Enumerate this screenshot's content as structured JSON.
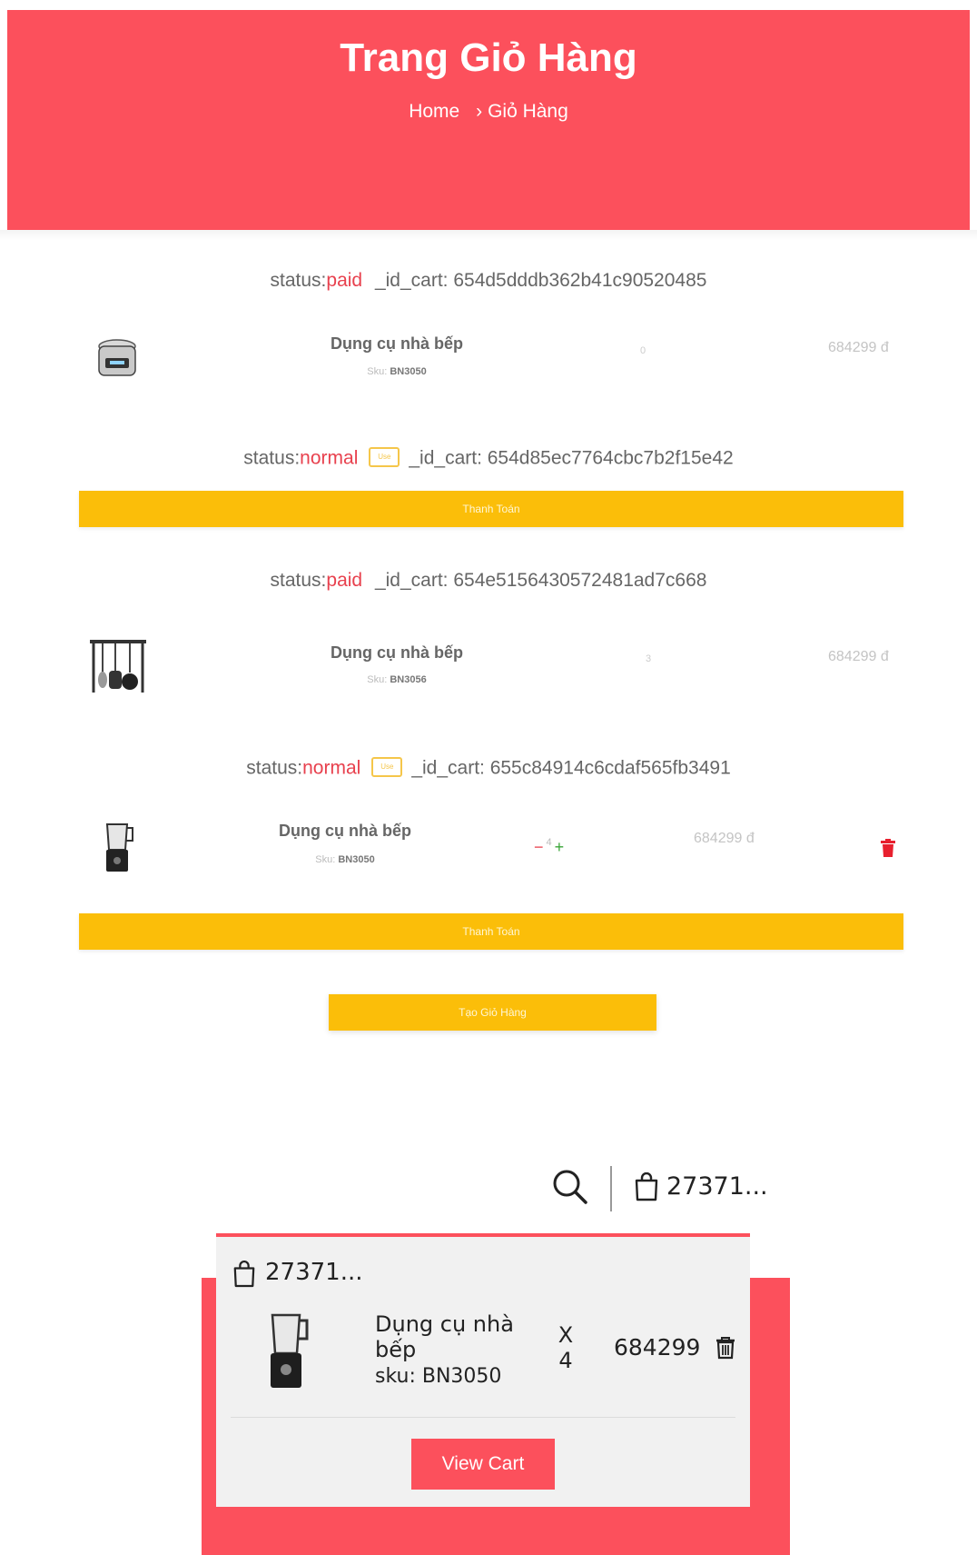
{
  "page": {
    "title": "Trang Giỏ Hàng",
    "breadcrumb": {
      "home": "Home",
      "separator": "›",
      "current": "Giỏ Hàng"
    }
  },
  "colors": {
    "accent": "#fc505c",
    "button": "#fbbe09",
    "status": "#e8414e",
    "plus": "#39a537"
  },
  "carts": [
    {
      "status_prefix": "status:",
      "status": "paid",
      "id_text": "_id_cart: 654d5dddb362b41c90520485",
      "item": {
        "name": "Dụng cụ nhà bếp",
        "sku_label": "Sku:",
        "sku": "BN3050",
        "qty": "0",
        "price": "684299 đ",
        "image_icon": "rice-cooker-icon"
      }
    },
    {
      "status_prefix": "status:",
      "status": "normal",
      "badge": "Use",
      "id_text": "_id_cart: 654d85ec7764cbc7b2f15e42",
      "pay_label": "Thanh Toán"
    },
    {
      "status_prefix": "status:",
      "status": "paid",
      "id_text": "_id_cart: 654e5156430572481ad7c668",
      "item": {
        "name": "Dụng cụ nhà bếp",
        "sku_label": "Sku:",
        "sku": "BN3056",
        "qty": "3",
        "price": "684299 đ",
        "image_icon": "utensil-rack-icon"
      }
    },
    {
      "status_prefix": "status:",
      "status": "normal",
      "badge": "Use",
      "id_text": "_id_cart: 655c84914c6cdaf565fb3491",
      "item": {
        "name": "Dụng cụ nhà bếp",
        "sku_label": "Sku:",
        "sku": "BN3050",
        "qty": "4",
        "minus": "−",
        "plus": "+",
        "price": "684299 đ",
        "image_icon": "blender-icon"
      },
      "pay_label": "Thanh Toán"
    }
  ],
  "create_cart_label": "Tạo Giỏ Hàng",
  "mini_header": {
    "cart_total": "27371..."
  },
  "mini_cart": {
    "total": "27371...",
    "item": {
      "name": "Dụng cụ nhà bếp",
      "sku": "sku: BN3050",
      "x_label": "X",
      "qty": "4",
      "price": "684299"
    },
    "view_cart_label": "View Cart"
  }
}
